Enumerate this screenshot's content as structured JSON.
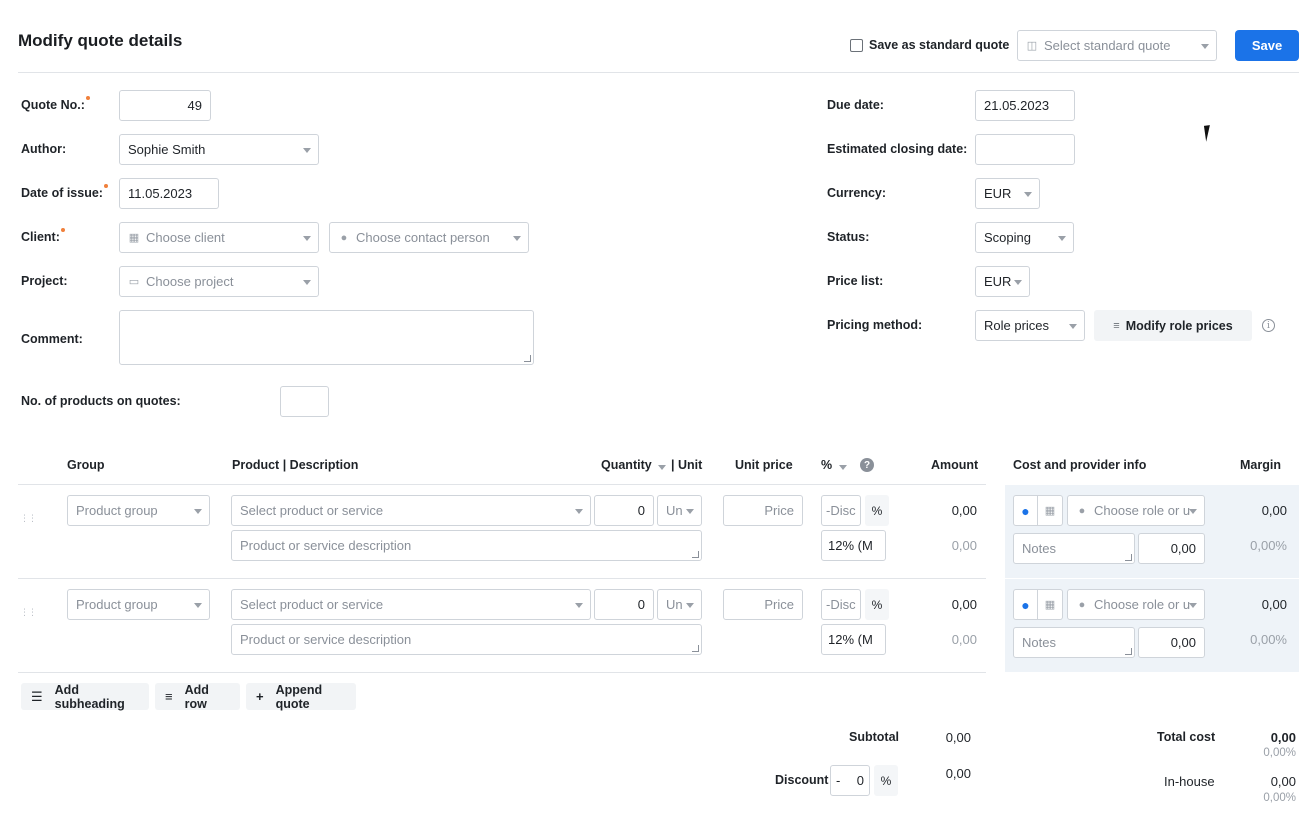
{
  "header": {
    "title": "Modify quote details",
    "save_standard_label": "Save as standard quote",
    "standard_quote_placeholder": "Select standard quote",
    "save_label": "Save"
  },
  "form_left": {
    "quote_no_label": "Quote No.:",
    "quote_no_value": "49",
    "author_label": "Author:",
    "author_value": "Sophie Smith",
    "date_label": "Date of issue:",
    "date_value": "11.05.2023",
    "client_label": "Client:",
    "client_placeholder": "Choose client",
    "contact_placeholder": "Choose contact person",
    "project_label": "Project:",
    "project_placeholder": "Choose project",
    "comment_label": "Comment:",
    "products_label": "No. of products on quotes:"
  },
  "form_right": {
    "due_label": "Due date:",
    "due_value": "21.05.2023",
    "closing_label": "Estimated closing date:",
    "currency_label": "Currency:",
    "currency_value": "EUR",
    "status_label": "Status:",
    "status_value": "Scoping",
    "pricelist_label": "Price list:",
    "pricelist_value": "EUR",
    "pricing_label": "Pricing method:",
    "pricing_value": "Role prices",
    "modify_prices_label": "Modify role prices"
  },
  "table": {
    "headers": {
      "group": "Group",
      "product": "Product | Description",
      "quantity": "Quantity",
      "unit": "| Unit",
      "unit_price": "Unit price",
      "percent": "%",
      "amount": "Amount",
      "cost": "Cost and provider info",
      "margin": "Margin"
    },
    "rows": [
      {
        "group_placeholder": "Product group",
        "product_placeholder": "Select product or service",
        "description_placeholder": "Product or service description",
        "quantity": "0",
        "unit": "Un",
        "price_placeholder": "Price",
        "discount_placeholder": "-Disc",
        "pct": "%",
        "vat": "12% (M",
        "amount": "0,00",
        "amount2": "0,00",
        "role_placeholder": "Choose role or u",
        "notes_placeholder": "Notes",
        "cost": "0,00",
        "margin": "0,00",
        "margin_pct": "0,00%"
      },
      {
        "group_placeholder": "Product group",
        "product_placeholder": "Select product or service",
        "description_placeholder": "Product or service description",
        "quantity": "0",
        "unit": "Un",
        "price_placeholder": "Price",
        "discount_placeholder": "-Disc",
        "pct": "%",
        "vat": "12% (M",
        "amount": "0,00",
        "amount2": "0,00",
        "role_placeholder": "Choose role or u",
        "notes_placeholder": "Notes",
        "cost": "0,00",
        "margin": "0,00",
        "margin_pct": "0,00%"
      }
    ]
  },
  "actions": {
    "add_subheading": "Add subheading",
    "add_row": "Add row",
    "append_quote": "Append quote"
  },
  "totals": {
    "subtotal_label": "Subtotal",
    "subtotal_value": "0,00",
    "discount_label": "Discount",
    "discount_sign": "-",
    "discount_value": "0",
    "discount_unit": "%",
    "discount_amount": "0,00",
    "total_cost_label": "Total cost",
    "total_cost_value": "0,00",
    "total_cost_pct": "0,00%",
    "inhouse_label": "In-house",
    "inhouse_value": "0,00",
    "inhouse_pct": "0,00%"
  }
}
